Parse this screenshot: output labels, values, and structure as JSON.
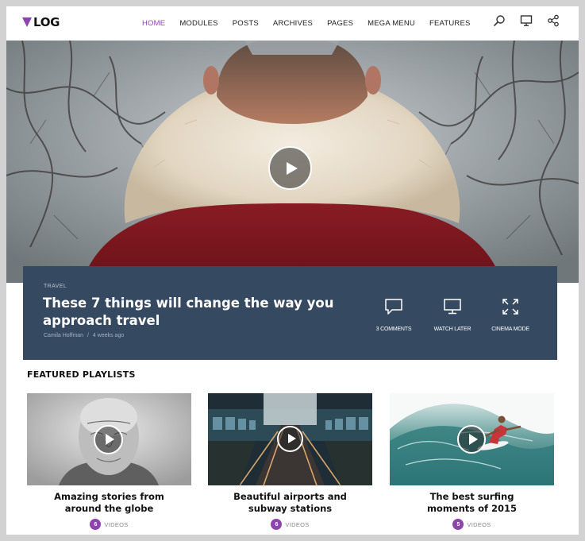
{
  "app": {
    "logo": "LOG",
    "brand_color": "#8e44ad"
  },
  "nav": {
    "items": [
      "HOME",
      "MODULES",
      "POSTS",
      "ARCHIVES",
      "PAGES",
      "MEGA MENU",
      "FEATURES"
    ],
    "active": "HOME"
  },
  "header_icons": [
    "search-icon",
    "monitor-icon",
    "share-icon"
  ],
  "hero": {
    "category": "TRAVEL",
    "title": "These 7 things will change the way you approach travel",
    "author": "Camila Hoffman",
    "separator": "/",
    "time_ago": "4 weeks ago",
    "actions": [
      {
        "icon": "comment-icon",
        "label": "3 COMMENTS"
      },
      {
        "icon": "monitor-icon",
        "label": "WATCH LATER"
      },
      {
        "icon": "expand-icon",
        "label": "CINEMA MODE"
      }
    ]
  },
  "featured": {
    "title": "FEATURED PLAYLISTS",
    "videos_label": "VIDEOS",
    "playlists": [
      {
        "title_line1": "Amazing stories from",
        "title_line2": "around the globe",
        "count": "6"
      },
      {
        "title_line1": "Beautiful airports and",
        "title_line2": "subway stations",
        "count": "6"
      },
      {
        "title_line1": "The best surfing",
        "title_line2": "moments of 2015",
        "count": "5"
      }
    ]
  }
}
